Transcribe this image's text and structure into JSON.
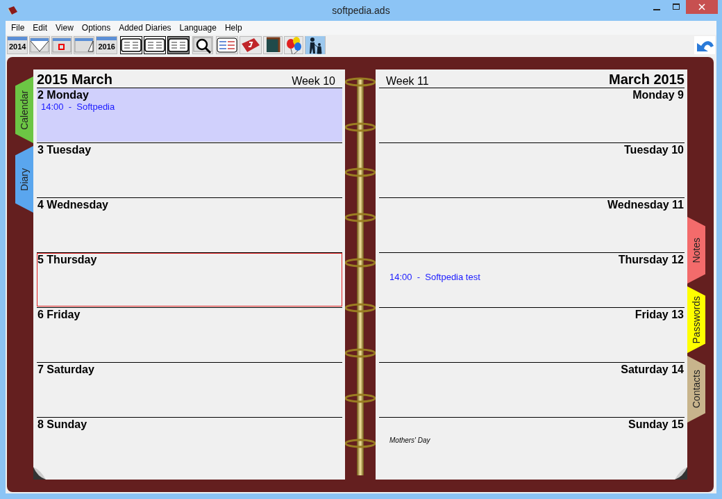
{
  "window": {
    "title": "softpedia.ads"
  },
  "menu": [
    "File",
    "Edit",
    "View",
    "Options",
    "Added Diaries",
    "Language",
    "Help"
  ],
  "toolbar": [
    [
      {
        "kind": "year",
        "label": "2014"
      },
      {
        "kind": "prev-month"
      },
      {
        "kind": "today"
      },
      {
        "kind": "next-month"
      },
      {
        "kind": "year",
        "label": "2016"
      }
    ],
    [
      {
        "kind": "layout",
        "pressed": false
      },
      {
        "kind": "layout",
        "pressed": false
      },
      {
        "kind": "layout",
        "pressed": true
      }
    ],
    [
      {
        "kind": "search"
      }
    ],
    [
      {
        "kind": "list"
      },
      {
        "kind": "book"
      },
      {
        "kind": "texture"
      },
      {
        "kind": "balloons"
      },
      {
        "kind": "family"
      }
    ]
  ],
  "left_tabs": [
    {
      "label": "Calendar",
      "color": "#6cc644"
    },
    {
      "label": "Diary",
      "color": "#5aa6ee"
    }
  ],
  "right_tabs": [
    {
      "label": "Notes",
      "color": "#f36b6b"
    },
    {
      "label": "Passwords",
      "color": "#ffff00"
    },
    {
      "label": "Contacts",
      "color": "#c8b48c"
    }
  ],
  "pages": [
    {
      "title": "2015 March",
      "week": "Week 10",
      "days": [
        {
          "label": "2 Monday",
          "highlighted": true,
          "today": false,
          "entries": [
            {
              "kind": "appointment",
              "text": "14:00  -  Softpedia"
            }
          ]
        },
        {
          "label": "3 Tuesday",
          "highlighted": false,
          "today": false
        },
        {
          "label": "4 Wednesday",
          "highlighted": false,
          "today": false
        },
        {
          "label": "5 Thursday",
          "highlighted": false,
          "today": true
        },
        {
          "label": "6 Friday",
          "highlighted": false,
          "today": false
        },
        {
          "label": "7 Saturday",
          "highlighted": false,
          "today": false
        },
        {
          "label": "8 Sunday",
          "highlighted": false,
          "today": false
        }
      ]
    },
    {
      "title": "March 2015",
      "week": "Week 11",
      "days": [
        {
          "label": "Monday 9",
          "highlighted": false,
          "today": false
        },
        {
          "label": "Tuesday 10",
          "highlighted": false,
          "today": false
        },
        {
          "label": "Wednesday 11",
          "highlighted": false,
          "today": false
        },
        {
          "label": "Thursday 12",
          "highlighted": false,
          "today": false,
          "entries": [
            {
              "kind": "appointment",
              "text": "14:00  -  Softpedia test"
            }
          ]
        },
        {
          "label": "Friday 13",
          "highlighted": false,
          "today": false
        },
        {
          "label": "Saturday 14",
          "highlighted": false,
          "today": false
        },
        {
          "label": "Sunday 15",
          "highlighted": false,
          "today": false,
          "entries": [
            {
              "kind": "holiday",
              "text": "Mothers' Day"
            }
          ]
        }
      ]
    }
  ]
}
